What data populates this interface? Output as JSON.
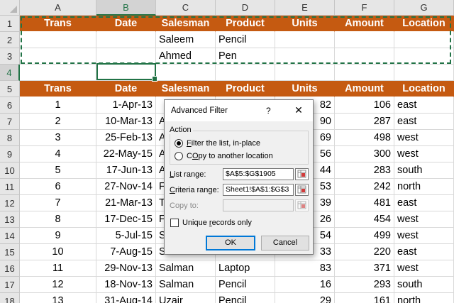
{
  "columns": [
    "A",
    "B",
    "C",
    "D",
    "E",
    "F",
    "G"
  ],
  "header_labels": [
    "Trans",
    "Date",
    "Salesman",
    "Product",
    "Units",
    "Amount",
    "Location"
  ],
  "criteria_rows": [
    [
      "",
      "",
      "Saleem",
      "Pencil",
      "",
      "",
      ""
    ],
    [
      "",
      "",
      "Ahmed",
      "Pen",
      "",
      "",
      ""
    ],
    [
      "",
      "",
      "",
      "",
      "",
      "",
      ""
    ]
  ],
  "data_rows": [
    [
      "1",
      "1-Apr-13",
      "",
      "",
      "82",
      "106",
      "east"
    ],
    [
      "2",
      "10-Mar-13",
      "A",
      "",
      "90",
      "287",
      "east"
    ],
    [
      "3",
      "25-Feb-13",
      "A",
      "",
      "69",
      "498",
      "west"
    ],
    [
      "4",
      "22-May-15",
      "A",
      "",
      "56",
      "300",
      "west"
    ],
    [
      "5",
      "17-Jun-13",
      "A",
      "",
      "44",
      "283",
      "south"
    ],
    [
      "6",
      "27-Nov-14",
      "F",
      "",
      "53",
      "242",
      "north"
    ],
    [
      "7",
      "21-Mar-13",
      "T",
      "",
      "39",
      "481",
      "east"
    ],
    [
      "8",
      "17-Dec-15",
      "F",
      "",
      "26",
      "454",
      "west"
    ],
    [
      "9",
      "5-Jul-15",
      "S",
      "",
      "54",
      "499",
      "west"
    ],
    [
      "10",
      "7-Aug-15",
      "S",
      "",
      "33",
      "220",
      "east"
    ],
    [
      "11",
      "29-Nov-13",
      "Salman",
      "Laptop",
      "83",
      "371",
      "west"
    ],
    [
      "12",
      "18-Nov-13",
      "Salman",
      "Pencil",
      "16",
      "293",
      "south"
    ],
    [
      "13",
      "31-Aug-14",
      "Uzair",
      "Pencil",
      "29",
      "161",
      "north"
    ]
  ],
  "row_numbers": [
    "1",
    "2",
    "3",
    "4",
    "5",
    "6",
    "7",
    "8",
    "9",
    "10",
    "11",
    "12",
    "13",
    "14",
    "15",
    "16",
    "17",
    "18"
  ],
  "colors": {
    "header_fill": "#c55a11",
    "selection": "#217346",
    "dialog_default": "#0078d7"
  },
  "dialog": {
    "title": "Advanced Filter",
    "help": "?",
    "close": "✕",
    "action_label": "Action",
    "radio_filter_pre": "",
    "radio_filter_u": "F",
    "radio_filter_post": "ilter the list, in-place",
    "radio_copy_pre": "",
    "radio_copy_u": "O",
    "radio_copy_post": "Copy to another location",
    "list_range_label_u": "L",
    "list_range_label_post": "ist range:",
    "list_range_value": "$A$5:$G$1905",
    "criteria_label_u": "C",
    "criteria_label_post": "riteria range:",
    "criteria_value": "Sheet1!$A$1:$G$3",
    "copy_to_label": "Copy to:",
    "copy_to_value": "",
    "unique_pre": "Unique ",
    "unique_u": "r",
    "unique_post": "ecords only",
    "ok": "OK",
    "cancel": "Cancel",
    "filter_selected": true,
    "unique_checked": false
  }
}
